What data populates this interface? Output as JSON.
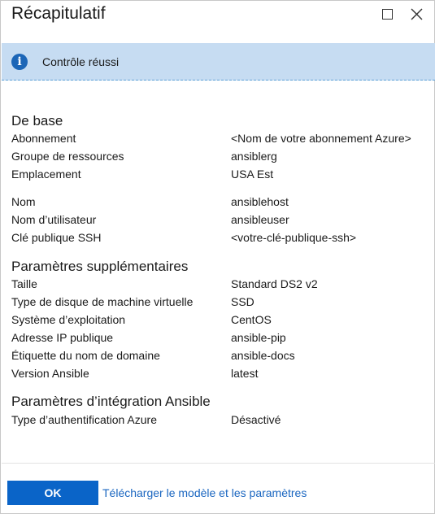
{
  "dialog": {
    "title": "Récapitulatif",
    "maximize_icon": "maximize-icon",
    "close_icon": "close-icon"
  },
  "banner": {
    "icon": "info-icon",
    "icon_glyph": "i",
    "message": "Contrôle réussi",
    "background": "#c6dcf2",
    "icon_color": "#1c66b7"
  },
  "sections": {
    "basics": {
      "title": "De base",
      "rows": [
        {
          "label": "Abonnement",
          "value": "<Nom de votre abonnement Azure>"
        },
        {
          "label": "Groupe de ressources",
          "value": "ansiblerg"
        },
        {
          "label": "Emplacement",
          "value": "USA Est"
        },
        {
          "label": "Nom",
          "value": "ansiblehost"
        },
        {
          "label": "Nom d’utilisateur",
          "value": "ansibleuser"
        },
        {
          "label": "Clé publique SSH",
          "value": "<votre-clé-publique-ssh>"
        }
      ]
    },
    "extra": {
      "title": "Paramètres supplémentaires",
      "rows": [
        {
          "label": "Taille",
          "value": "Standard DS2 v2"
        },
        {
          "label": "Type de disque de machine virtuelle",
          "value": "SSD"
        },
        {
          "label": "Système d’exploitation",
          "value": "CentOS"
        },
        {
          "label": "Adresse IP publique",
          "value": "ansible-pip"
        },
        {
          "label": "Étiquette du nom de domaine",
          "value": "ansible-docs"
        },
        {
          "label": "Version Ansible",
          "value": "latest"
        }
      ]
    },
    "integration": {
      "title": "Paramètres d’intégration Ansible",
      "rows": [
        {
          "label": "Type d’authentification Azure",
          "value": "Désactivé"
        }
      ]
    }
  },
  "footer": {
    "ok_label": "OK",
    "download_link": "Télécharger le modèle et les paramètres",
    "accent": "#0a64c8"
  }
}
